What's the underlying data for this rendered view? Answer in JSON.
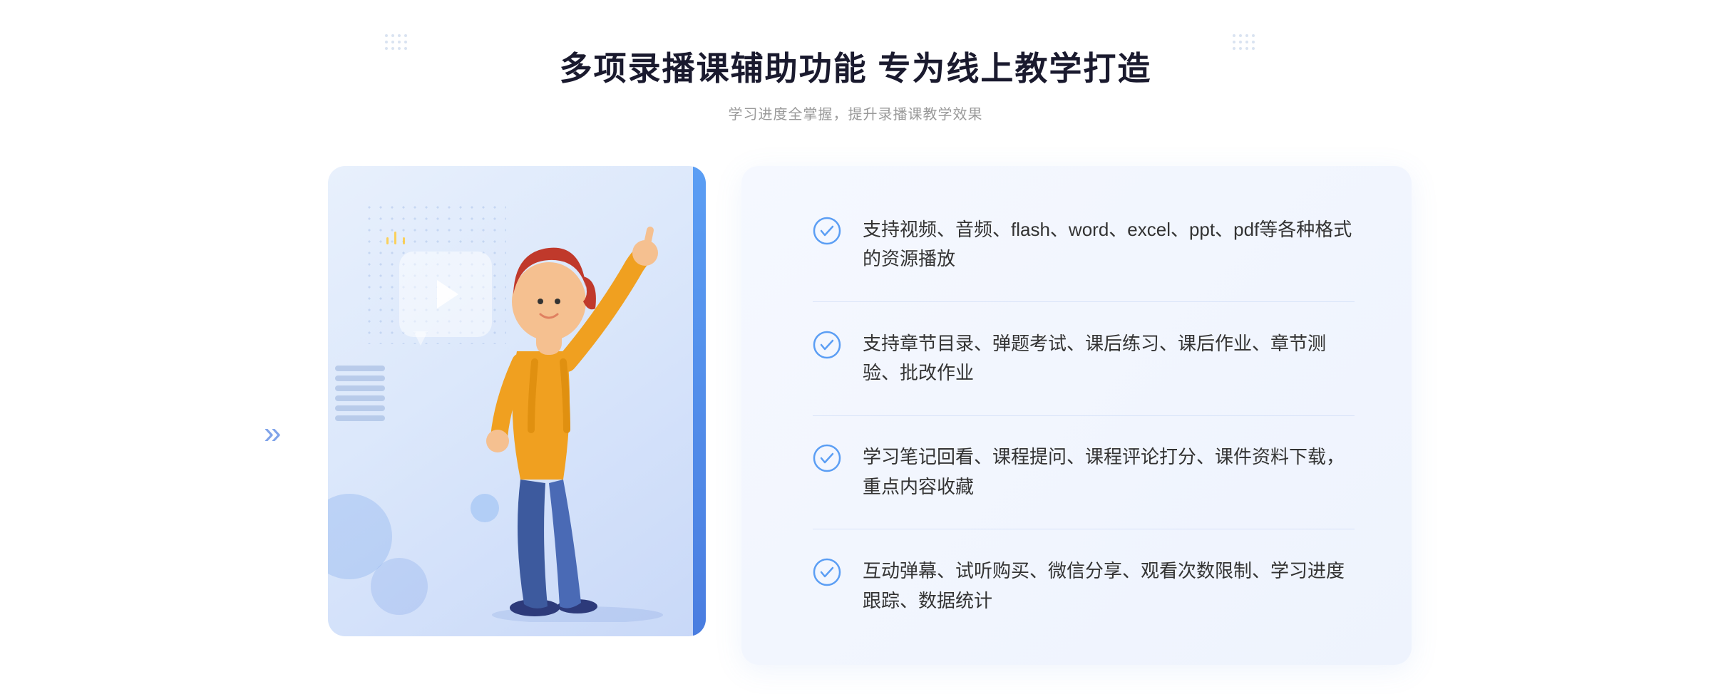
{
  "header": {
    "main_title": "多项录播课辅助功能 专为线上教学打造",
    "sub_title": "学习进度全掌握，提升录播课教学效果"
  },
  "features": [
    {
      "id": "feature-1",
      "text": "支持视频、音频、flash、word、excel、ppt、pdf等各种格式的资源播放"
    },
    {
      "id": "feature-2",
      "text": "支持章节目录、弹题考试、课后练习、课后作业、章节测验、批改作业"
    },
    {
      "id": "feature-3",
      "text": "学习笔记回看、课程提问、课程评论打分、课件资料下载，重点内容收藏"
    },
    {
      "id": "feature-4",
      "text": "互动弹幕、试听购买、微信分享、观看次数限制、学习进度跟踪、数据统计"
    }
  ],
  "colors": {
    "primary_blue": "#4a7de0",
    "light_blue": "#7aabf5",
    "text_dark": "#333333",
    "text_gray": "#999999",
    "check_color": "#5b9ef4"
  },
  "decorations": {
    "dots_pattern": "··",
    "chevron": "»"
  }
}
